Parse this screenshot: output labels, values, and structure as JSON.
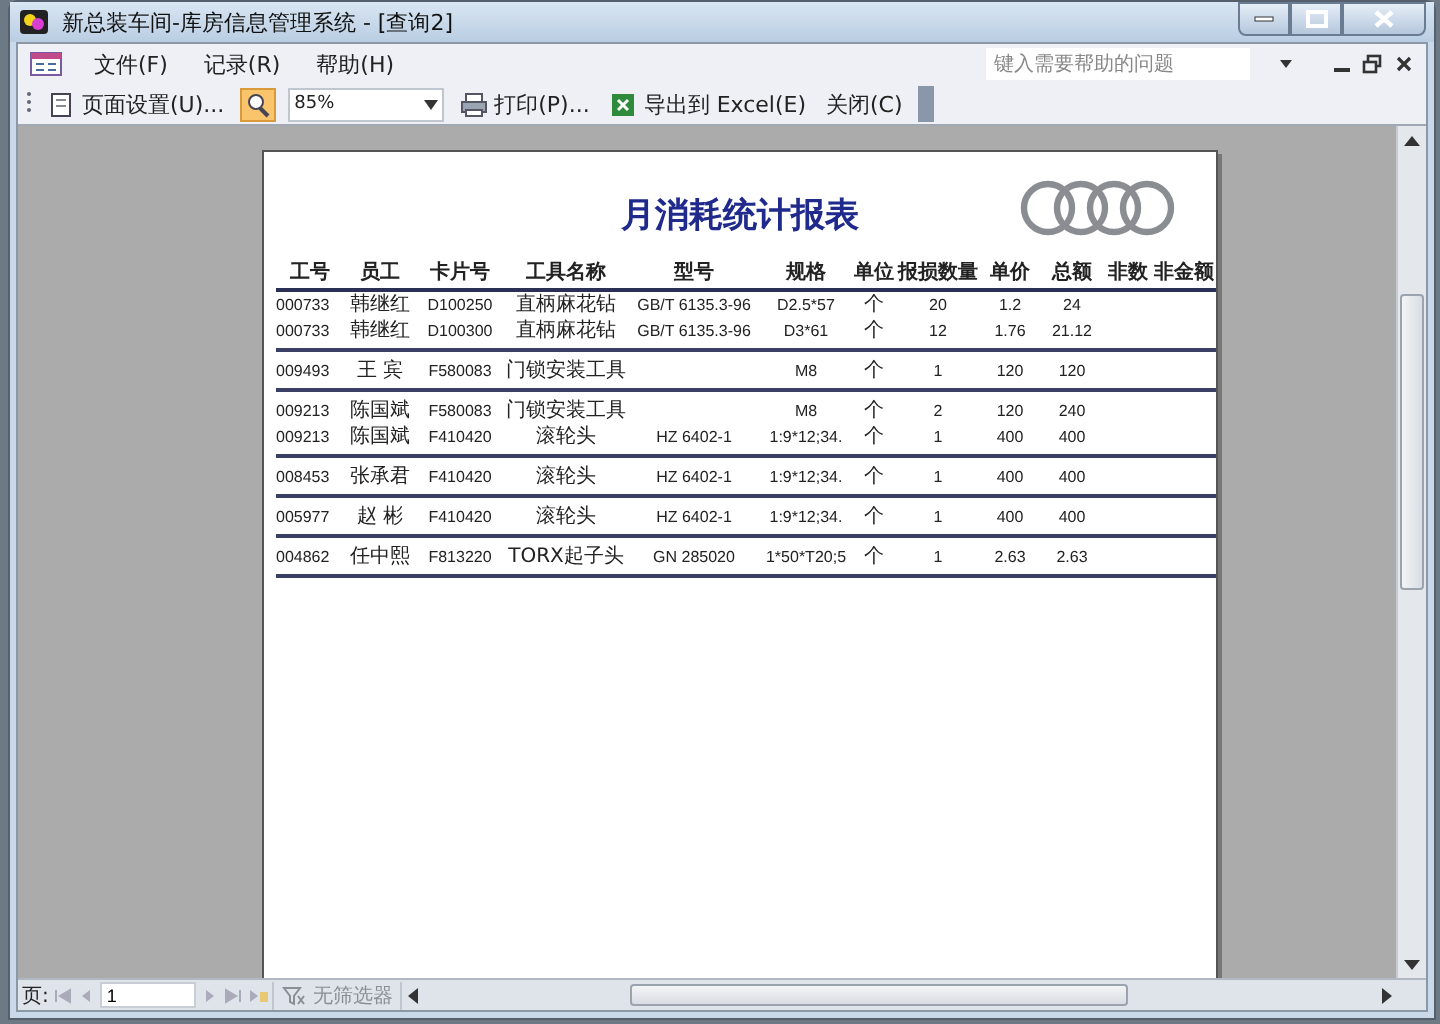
{
  "window": {
    "title": "新总装车间-库房信息管理系统 - [查询2]"
  },
  "menu": [
    {
      "label": "文件(F)"
    },
    {
      "label": "记录(R)"
    },
    {
      "label": "帮助(H)"
    }
  ],
  "help_box": {
    "placeholder": "键入需要帮助的问题"
  },
  "toolbar": {
    "page_setup": "页面设置(U)...",
    "zoom": "85%",
    "print": "打印(P)...",
    "export": "导出到 Excel(E)",
    "close": "关闭(C)"
  },
  "report": {
    "title": "月消耗统计报表",
    "columns": [
      "工号",
      "员工",
      "卡片号",
      "工具名称",
      "型号",
      "规格",
      "单位",
      "报损数量",
      "单价",
      "总额",
      "非数",
      "非金额"
    ],
    "groups": [
      {
        "rows": [
          {
            "id": "000733",
            "staff": "韩继红",
            "card": "D100250",
            "tool": "直柄麻花钻",
            "model": "GB/T 6135.3-96",
            "spec": "D2.5*57",
            "unit": "个",
            "qty": "20",
            "price": "1.2",
            "total": "24"
          },
          {
            "id": "000733",
            "staff": "韩继红",
            "card": "D100300",
            "tool": "直柄麻花钻",
            "model": "GB/T 6135.3-96",
            "spec": "D3*61",
            "unit": "个",
            "qty": "12",
            "price": "1.76",
            "total": "21.12"
          }
        ]
      },
      {
        "rows": [
          {
            "id": "009493",
            "staff": "王 宾",
            "card": "F580083",
            "tool": "门锁安装工具",
            "spec": "M8",
            "unit": "个",
            "qty": "1",
            "price": "120",
            "total": "120"
          }
        ]
      },
      {
        "rows": [
          {
            "id": "009213",
            "staff": "陈国斌",
            "card": "F580083",
            "tool": "门锁安装工具",
            "spec": "M8",
            "unit": "个",
            "qty": "2",
            "price": "120",
            "total": "240"
          },
          {
            "id": "009213",
            "staff": "陈国斌",
            "card": "F410420",
            "tool": "滚轮头",
            "model": "HZ 6402-1",
            "spec": "1:9*12;34.",
            "unit": "个",
            "qty": "1",
            "price": "400",
            "total": "400"
          }
        ]
      },
      {
        "rows": [
          {
            "id": "008453",
            "staff": "张承君",
            "card": "F410420",
            "tool": "滚轮头",
            "model": "HZ 6402-1",
            "spec": "1:9*12;34.",
            "unit": "个",
            "qty": "1",
            "price": "400",
            "total": "400"
          }
        ]
      },
      {
        "rows": [
          {
            "id": "005977",
            "staff": "赵 彬",
            "card": "F410420",
            "tool": "滚轮头",
            "model": "HZ 6402-1",
            "spec": "1:9*12;34.",
            "unit": "个",
            "qty": "1",
            "price": "400",
            "total": "400"
          }
        ]
      },
      {
        "rows": [
          {
            "id": "004862",
            "staff": "任中熙",
            "card": "F813220",
            "tool": "TORX起子头",
            "model": "GN 285020",
            "spec": "1*50*T20;5",
            "unit": "个",
            "qty": "1",
            "price": "2.63",
            "total": "2.63"
          }
        ]
      }
    ]
  },
  "record_nav": {
    "label": "页:",
    "page": "1",
    "filter": "无筛选器"
  }
}
